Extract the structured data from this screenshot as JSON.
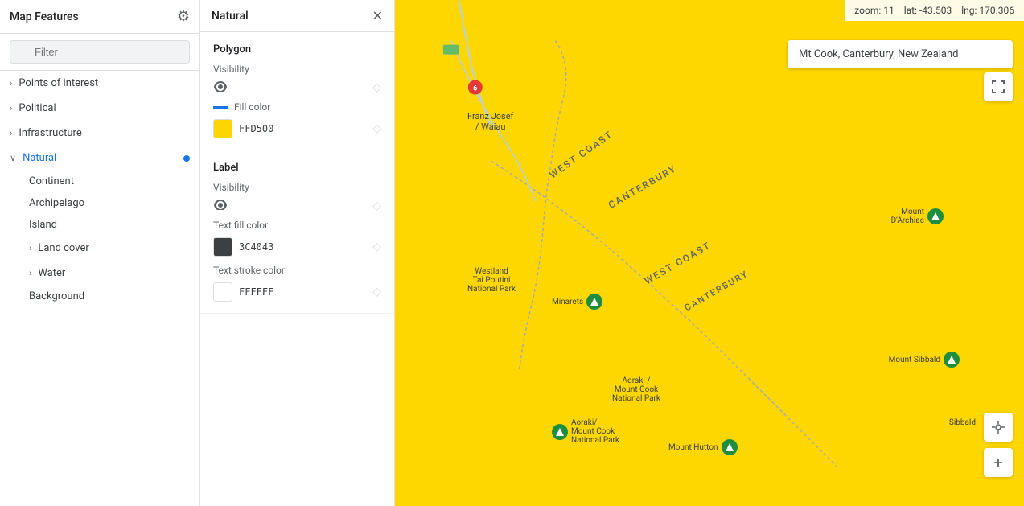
{
  "leftPanel": {
    "title": "Map Features",
    "filter": {
      "placeholder": "Filter"
    },
    "items": [
      {
        "id": "points-of-interest",
        "label": "Points of interest",
        "hasChevron": true,
        "active": false
      },
      {
        "id": "political",
        "label": "Political",
        "hasChevron": true,
        "active": false
      },
      {
        "id": "infrastructure",
        "label": "Infrastructure",
        "hasChevron": true,
        "active": false
      },
      {
        "id": "natural",
        "label": "Natural",
        "hasChevron": true,
        "active": true,
        "children": [
          {
            "id": "continent",
            "label": "Continent"
          },
          {
            "id": "archipelago",
            "label": "Archipelago"
          },
          {
            "id": "island",
            "label": "Island"
          },
          {
            "id": "land-cover",
            "label": "Land cover",
            "hasChevron": true
          },
          {
            "id": "water",
            "label": "Water",
            "hasChevron": true
          },
          {
            "id": "background",
            "label": "Background"
          }
        ]
      }
    ]
  },
  "middlePanel": {
    "title": "Natural",
    "sections": [
      {
        "id": "polygon",
        "sectionTitle": "Polygon",
        "visibility": {
          "label": "Visibility"
        },
        "fillColor": {
          "label": "Fill color",
          "swatch": "#FFD500",
          "code": "FFD500"
        }
      },
      {
        "id": "label",
        "sectionTitle": "Label",
        "visibility": {
          "label": "Visibility"
        },
        "textFillColor": {
          "label": "Text fill color",
          "swatch": "#3C4043",
          "code": "3C4043"
        },
        "textStrokeColor": {
          "label": "Text stroke color",
          "swatch": "#FFFFFF",
          "code": "FFFFFF"
        }
      }
    ]
  },
  "topBar": {
    "zoom": "zoom: 11",
    "lat": "lat: -43.503",
    "lng": "lng: 170.306"
  },
  "searchBox": {
    "value": "Mt Cook, Canterbury, New Zealand"
  },
  "mapLabels": {
    "westCoast1": "WEST COAST",
    "westCoast2": "WEST COAST",
    "canterbury1": "CANTERBURY",
    "canterbury2": "CANTERBURY",
    "franzJosef": "Franz Josef\n/ Waiau",
    "westlandPark": "Westland\nTai Poutini\nNational Park",
    "minarets": "Minarets",
    "mountDArchiac": "Mount\nD'Archiac",
    "mountSibbald": "Mount Sibbald",
    "aorakiPark1": "Aoraki /\nMount Cook\nNational Park",
    "aorakiPark2": "Aoraki/\nMount Cook\nNational Park",
    "mountHutton": "Mount Hutton",
    "sibbald": "Sibbald"
  },
  "icons": {
    "gear": "⚙",
    "close": "✕",
    "filter": "≡",
    "chevronRight": "›",
    "chevronDown": "∨",
    "eye": "👁",
    "diamond": "◇",
    "location": "◎",
    "zoomIn": "+",
    "fullscreen": "⛶"
  }
}
